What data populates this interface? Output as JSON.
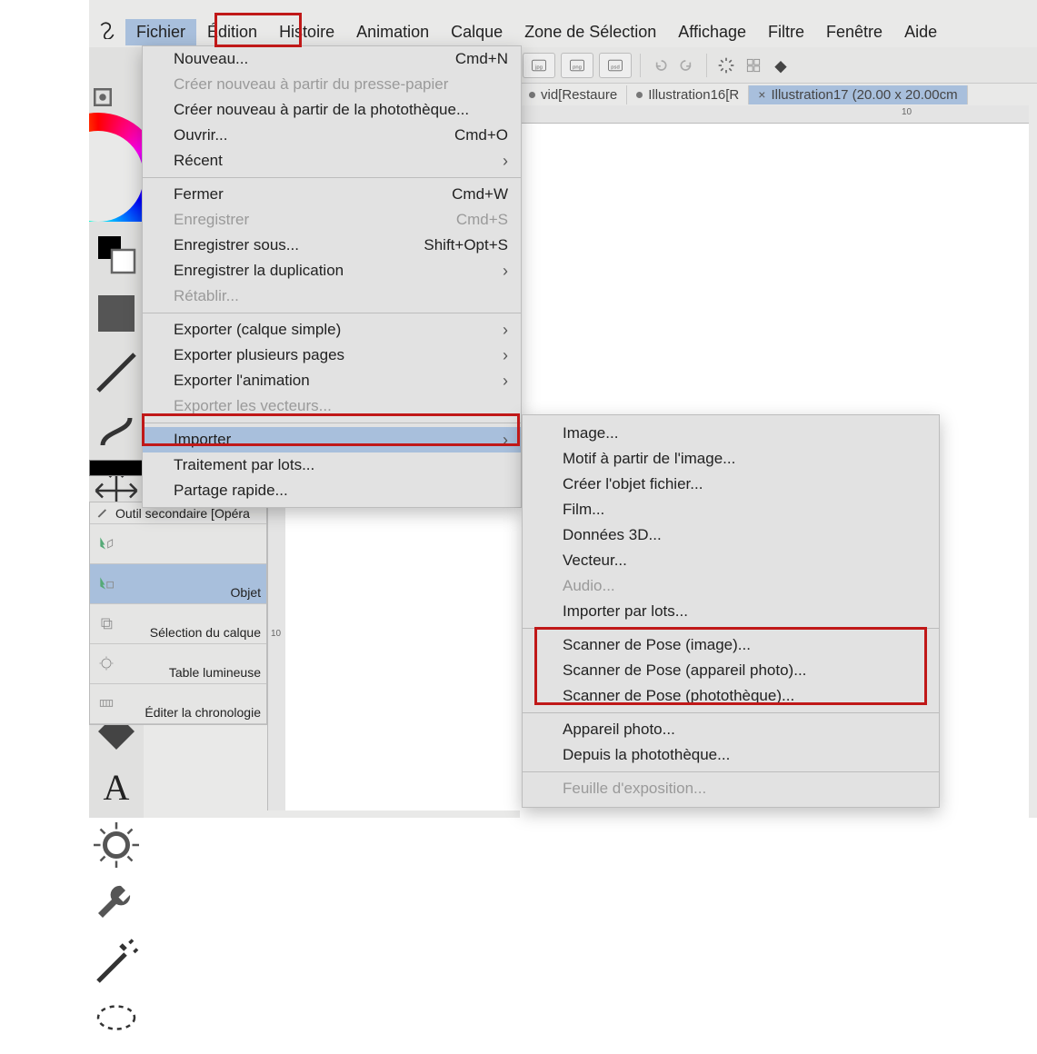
{
  "menubar": {
    "items": [
      "Fichier",
      "Édition",
      "Histoire",
      "Animation",
      "Calque",
      "Zone de Sélection",
      "Affichage",
      "Filtre",
      "Fenêtre",
      "Aide"
    ]
  },
  "toolbar": {
    "icons": [
      "jpg",
      "png",
      "psd"
    ],
    "undo": "undo",
    "redo": "redo",
    "loading": "loading",
    "grid": "grid",
    "bucket": "bucket"
  },
  "doctabs": [
    {
      "label": "vid[Restaure",
      "modified": true,
      "active": false
    },
    {
      "label": "Illustration16[R",
      "modified": true,
      "active": false
    },
    {
      "label": "Illustration17 (20.00 x 20.00cm",
      "modified": false,
      "active": true,
      "close": "×"
    }
  ],
  "ruler": {
    "mark": "10"
  },
  "subtool": {
    "title": "Outil secondaire [Opéra",
    "rows": [
      {
        "label": "",
        "selected": false
      },
      {
        "label": "Objet",
        "selected": true
      },
      {
        "label": "Sélection du calque",
        "selected": false
      },
      {
        "label": "Table lumineuse",
        "selected": false
      },
      {
        "label": "Éditer la chronologie",
        "selected": false
      }
    ]
  },
  "file_menu": [
    {
      "label": "Nouveau...",
      "shortcut": "Cmd+N"
    },
    {
      "label": "Créer nouveau à partir du presse-papier",
      "disabled": true
    },
    {
      "label": "Créer nouveau à partir de la photothèque..."
    },
    {
      "label": "Ouvrir...",
      "shortcut": "Cmd+O"
    },
    {
      "label": "Récent",
      "arrow": true
    },
    {
      "sep": true
    },
    {
      "label": "Fermer",
      "shortcut": "Cmd+W"
    },
    {
      "label": "Enregistrer",
      "shortcut": "Cmd+S",
      "disabled": true
    },
    {
      "label": "Enregistrer sous...",
      "shortcut": "Shift+Opt+S"
    },
    {
      "label": "Enregistrer la duplication",
      "arrow": true
    },
    {
      "label": "Rétablir...",
      "disabled": true
    },
    {
      "sep": true
    },
    {
      "label": "Exporter (calque simple)",
      "arrow": true
    },
    {
      "label": "Exporter plusieurs pages",
      "arrow": true
    },
    {
      "label": "Exporter l'animation",
      "arrow": true
    },
    {
      "label": "Exporter les vecteurs...",
      "disabled": true
    },
    {
      "sep": true
    },
    {
      "label": "Importer",
      "arrow": true,
      "selected": true
    },
    {
      "label": "Traitement par lots..."
    },
    {
      "label": "Partage rapide..."
    }
  ],
  "import_submenu": [
    {
      "label": "Image..."
    },
    {
      "label": "Motif à partir de l'image..."
    },
    {
      "label": "Créer l'objet fichier..."
    },
    {
      "label": "Film..."
    },
    {
      "label": "Données 3D..."
    },
    {
      "label": "Vecteur..."
    },
    {
      "label": "Audio...",
      "disabled": true
    },
    {
      "label": "Importer par lots..."
    },
    {
      "sep": true
    },
    {
      "label": "Scanner de Pose (image)..."
    },
    {
      "label": "Scanner de Pose (appareil photo)..."
    },
    {
      "label": "Scanner de Pose (photothèque)..."
    },
    {
      "sep": true
    },
    {
      "label": "Appareil photo..."
    },
    {
      "label": "Depuis la photothèque..."
    },
    {
      "sep": true
    },
    {
      "label": "Feuille d'exposition...",
      "disabled": true
    }
  ],
  "highlight_colors": {
    "red": "#c01818"
  }
}
